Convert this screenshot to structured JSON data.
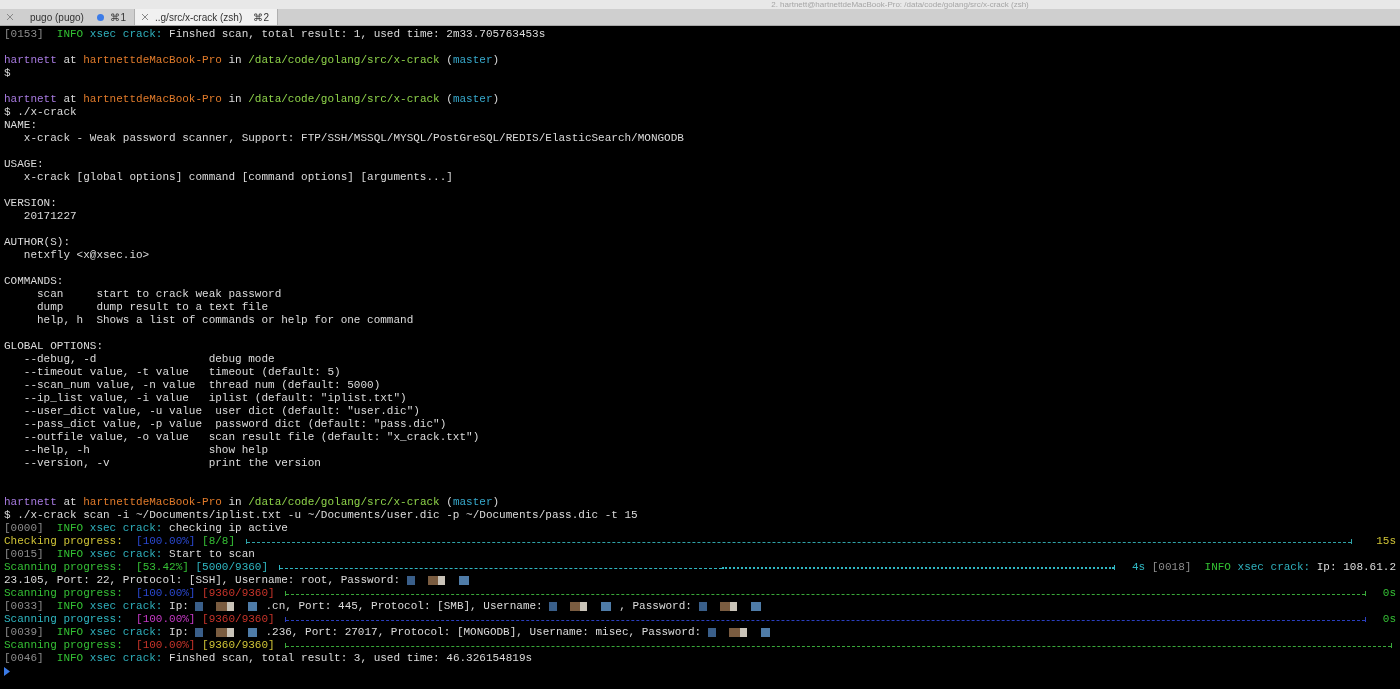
{
  "window": {
    "title": "2. hartnett@hartnettdeMacBook-Pro: /data/code/golang/src/x-crack (zsh)"
  },
  "tabs": [
    {
      "label": "pugo (pugo)",
      "shortcut": "⌘1",
      "selected": false,
      "activity": true
    },
    {
      "label": "..g/src/x-crack (zsh)",
      "shortcut": "⌘2",
      "selected": true,
      "activity": false
    }
  ],
  "lines": [
    {
      "kind": "text",
      "segments": [
        {
          "kind": "dim",
          "text": "[0153]"
        },
        {
          "kind": "info",
          "text": "  INFO"
        },
        {
          "kind": "tag",
          "text": " xsec crack:"
        },
        {
          "kind": "plain",
          "text": " Finshed scan, total result: 1, used time: 2m33.705763453s"
        }
      ]
    },
    {
      "kind": "blank"
    },
    {
      "kind": "text",
      "segments": [
        {
          "kind": "user",
          "text": "hartnett"
        },
        {
          "kind": "plain",
          "text": " at "
        },
        {
          "kind": "host",
          "text": "hartnettdeMacBook-Pro"
        },
        {
          "kind": "plain",
          "text": " in "
        },
        {
          "kind": "path",
          "text": "/data/code/golang/src/x-crack"
        },
        {
          "kind": "plain",
          "text": " ("
        },
        {
          "kind": "branch",
          "text": "master"
        },
        {
          "kind": "plain",
          "text": ")"
        }
      ]
    },
    {
      "kind": "text",
      "segments": [
        {
          "kind": "plain",
          "text": "$"
        }
      ]
    },
    {
      "kind": "blank"
    },
    {
      "kind": "text",
      "segments": [
        {
          "kind": "user",
          "text": "hartnett"
        },
        {
          "kind": "plain",
          "text": " at "
        },
        {
          "kind": "host",
          "text": "hartnettdeMacBook-Pro"
        },
        {
          "kind": "plain",
          "text": " in "
        },
        {
          "kind": "path",
          "text": "/data/code/golang/src/x-crack"
        },
        {
          "kind": "plain",
          "text": " ("
        },
        {
          "kind": "branch",
          "text": "master"
        },
        {
          "kind": "plain",
          "text": ")"
        }
      ]
    },
    {
      "kind": "text",
      "segments": [
        {
          "kind": "plain",
          "text": "$ ./x-crack"
        }
      ]
    },
    {
      "kind": "text",
      "segments": [
        {
          "kind": "plain",
          "text": "NAME:"
        }
      ]
    },
    {
      "kind": "text",
      "segments": [
        {
          "kind": "plain",
          "text": "   x-crack - Weak password scanner, Support: FTP/SSH/MSSQL/MYSQL/PostGreSQL/REDIS/ElasticSearch/MONGODB"
        }
      ]
    },
    {
      "kind": "blank"
    },
    {
      "kind": "text",
      "segments": [
        {
          "kind": "plain",
          "text": "USAGE:"
        }
      ]
    },
    {
      "kind": "text",
      "segments": [
        {
          "kind": "plain",
          "text": "   x-crack [global options] command [command options] [arguments...]"
        }
      ]
    },
    {
      "kind": "blank"
    },
    {
      "kind": "text",
      "segments": [
        {
          "kind": "plain",
          "text": "VERSION:"
        }
      ]
    },
    {
      "kind": "text",
      "segments": [
        {
          "kind": "plain",
          "text": "   20171227"
        }
      ]
    },
    {
      "kind": "blank"
    },
    {
      "kind": "text",
      "segments": [
        {
          "kind": "plain",
          "text": "AUTHOR(S):"
        }
      ]
    },
    {
      "kind": "text",
      "segments": [
        {
          "kind": "plain",
          "text": "   netxfly <x@xsec.io>"
        }
      ]
    },
    {
      "kind": "blank"
    },
    {
      "kind": "text",
      "segments": [
        {
          "kind": "plain",
          "text": "COMMANDS:"
        }
      ]
    },
    {
      "kind": "text",
      "segments": [
        {
          "kind": "plain",
          "text": "     scan     start to crack weak password"
        }
      ]
    },
    {
      "kind": "text",
      "segments": [
        {
          "kind": "plain",
          "text": "     dump     dump result to a text file"
        }
      ]
    },
    {
      "kind": "text",
      "segments": [
        {
          "kind": "plain",
          "text": "     help, h  Shows a list of commands or help for one command"
        }
      ]
    },
    {
      "kind": "blank"
    },
    {
      "kind": "text",
      "segments": [
        {
          "kind": "plain",
          "text": "GLOBAL OPTIONS:"
        }
      ]
    },
    {
      "kind": "text",
      "segments": [
        {
          "kind": "plain",
          "text": "   --debug, -d                 debug mode"
        }
      ]
    },
    {
      "kind": "text",
      "segments": [
        {
          "kind": "plain",
          "text": "   --timeout value, -t value   timeout (default: 5)"
        }
      ]
    },
    {
      "kind": "text",
      "segments": [
        {
          "kind": "plain",
          "text": "   --scan_num value, -n value  thread num (default: 5000)"
        }
      ]
    },
    {
      "kind": "text",
      "segments": [
        {
          "kind": "plain",
          "text": "   --ip_list value, -i value   iplist (default: \"iplist.txt\")"
        }
      ]
    },
    {
      "kind": "text",
      "segments": [
        {
          "kind": "plain",
          "text": "   --user_dict value, -u value  user dict (default: \"user.dic\")"
        }
      ]
    },
    {
      "kind": "text",
      "segments": [
        {
          "kind": "plain",
          "text": "   --pass_dict value, -p value  password dict (default: \"pass.dic\")"
        }
      ]
    },
    {
      "kind": "text",
      "segments": [
        {
          "kind": "plain",
          "text": "   --outfile value, -o value   scan result file (default: \"x_crack.txt\")"
        }
      ]
    },
    {
      "kind": "text",
      "segments": [
        {
          "kind": "plain",
          "text": "   --help, -h                  show help"
        }
      ]
    },
    {
      "kind": "text",
      "segments": [
        {
          "kind": "plain",
          "text": "   --version, -v               print the version"
        }
      ]
    },
    {
      "kind": "blank"
    },
    {
      "kind": "blank"
    },
    {
      "kind": "text",
      "segments": [
        {
          "kind": "user",
          "text": "hartnett"
        },
        {
          "kind": "plain",
          "text": " at "
        },
        {
          "kind": "host",
          "text": "hartnettdeMacBook-Pro"
        },
        {
          "kind": "plain",
          "text": " in "
        },
        {
          "kind": "path",
          "text": "/data/code/golang/src/x-crack"
        },
        {
          "kind": "plain",
          "text": " ("
        },
        {
          "kind": "branch",
          "text": "master"
        },
        {
          "kind": "plain",
          "text": ")"
        }
      ]
    },
    {
      "kind": "text",
      "segments": [
        {
          "kind": "plain",
          "text": "$ ./x-crack scan -i ~/Documents/iplist.txt -u ~/Documents/user.dic -p ~/Documents/pass.dic -t 15"
        }
      ]
    },
    {
      "kind": "text",
      "segments": [
        {
          "kind": "dim",
          "text": "[0000]"
        },
        {
          "kind": "info",
          "text": "  INFO"
        },
        {
          "kind": "tag",
          "text": " xsec crack:"
        },
        {
          "kind": "plain",
          "text": " checking ip active"
        }
      ]
    },
    {
      "kind": "text",
      "segments": [
        {
          "kind": "yellow",
          "text": "Checking progress:"
        },
        {
          "kind": "blue",
          "text": "  [100.00%]"
        },
        {
          "kind": "green",
          "text": " [8/8] "
        },
        {
          "kind": "bar",
          "color": "#2fa3a8",
          "level": 1
        },
        {
          "kind": "yellow",
          "text": "   15s"
        }
      ]
    },
    {
      "kind": "text",
      "segments": [
        {
          "kind": "dim",
          "text": "[0015]"
        },
        {
          "kind": "info",
          "text": "  INFO"
        },
        {
          "kind": "tag",
          "text": " xsec crack:"
        },
        {
          "kind": "plain",
          "text": " Start to scan"
        }
      ]
    },
    {
      "kind": "text",
      "segments": [
        {
          "kind": "green",
          "text": "Scanning progress:"
        },
        {
          "kind": "green",
          "text": "  [53.42%]"
        },
        {
          "kind": "cyan",
          "text": " [5000/9360] "
        },
        {
          "kind": "bar",
          "color": "#2fb7c2",
          "level": 0.53
        },
        {
          "kind": "cyan",
          "text": "  4s "
        },
        {
          "kind": "dim",
          "text": "[0018]"
        },
        {
          "kind": "info",
          "text": "  INFO"
        },
        {
          "kind": "tag",
          "text": " xsec crack:"
        },
        {
          "kind": "plain",
          "text": " Ip: 108.61.2"
        }
      ]
    },
    {
      "kind": "text",
      "segments": [
        {
          "kind": "plain",
          "text": "23.105, Port: 22, Protocol: [SSH], Username: root, Password: "
        },
        {
          "kind": "redacted"
        }
      ]
    },
    {
      "kind": "text",
      "segments": [
        {
          "kind": "green",
          "text": "Scanning progress:"
        },
        {
          "kind": "blue",
          "text": "  [100.00%]"
        },
        {
          "kind": "red",
          "text": " [9360/9360] "
        },
        {
          "kind": "bar",
          "color": "#3aa83a",
          "level": 1
        },
        {
          "kind": "green",
          "text": "  0s"
        }
      ]
    },
    {
      "kind": "text",
      "segments": [
        {
          "kind": "dim",
          "text": "[0033]"
        },
        {
          "kind": "info",
          "text": "  INFO"
        },
        {
          "kind": "tag",
          "text": " xsec crack:"
        },
        {
          "kind": "plain",
          "text": " Ip: "
        },
        {
          "kind": "redacted"
        },
        {
          "kind": "plain",
          "text": ".cn, Port: 445, Protocol: [SMB], Username: "
        },
        {
          "kind": "redacted"
        },
        {
          "kind": "plain",
          "text": ", Password: "
        },
        {
          "kind": "redacted"
        }
      ]
    },
    {
      "kind": "text",
      "segments": [
        {
          "kind": "cyan",
          "text": "Scanning progress:"
        },
        {
          "kind": "magenta",
          "text": "  [100.00%]"
        },
        {
          "kind": "red",
          "text": " [9360/9360] "
        },
        {
          "kind": "bar",
          "color": "#2a3fc0",
          "level": 1
        },
        {
          "kind": "green",
          "text": "  0s"
        }
      ]
    },
    {
      "kind": "text",
      "segments": [
        {
          "kind": "dim",
          "text": "[0039]"
        },
        {
          "kind": "info",
          "text": "  INFO"
        },
        {
          "kind": "tag",
          "text": " xsec crack:"
        },
        {
          "kind": "plain",
          "text": " Ip: "
        },
        {
          "kind": "redacted"
        },
        {
          "kind": "plain",
          "text": ".236, Port: 27017, Protocol: [MONGODB], Username: misec, Password: "
        },
        {
          "kind": "redacted"
        }
      ]
    },
    {
      "kind": "text",
      "segments": [
        {
          "kind": "green",
          "text": "Scanning progress:"
        },
        {
          "kind": "red",
          "text": "  [100.00%]"
        },
        {
          "kind": "yellow",
          "text": " [9360/9360] "
        },
        {
          "kind": "bar",
          "color": "#3aa83a",
          "level": 1
        }
      ]
    },
    {
      "kind": "text",
      "segments": [
        {
          "kind": "dim",
          "text": "[0046]"
        },
        {
          "kind": "info",
          "text": "  INFO"
        },
        {
          "kind": "tag",
          "text": " xsec crack:"
        },
        {
          "kind": "plain",
          "text": " Finshed scan, total result: 3, used time: 46.326154819s"
        }
      ]
    },
    {
      "kind": "cursor"
    }
  ]
}
